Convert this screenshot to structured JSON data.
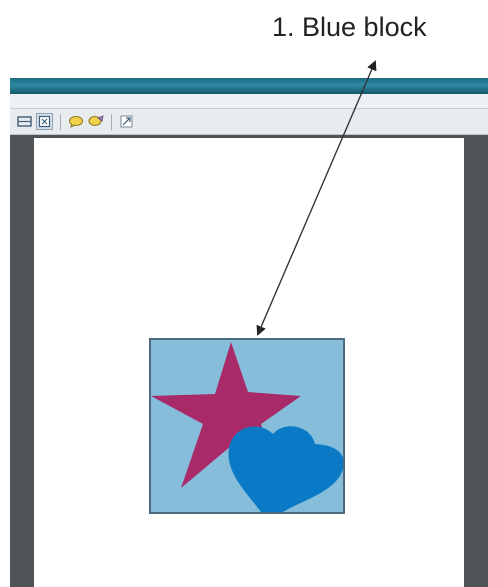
{
  "callout": {
    "label": "1. Blue block"
  },
  "colors": {
    "title_bar": "#2f8aa3",
    "workspace": "#4f5459",
    "page": "#ffffff",
    "blue_block": "#86bddb",
    "blue_block_border": "#4d6b7c",
    "star": "#a82a69",
    "heart": "#0b7ac6"
  },
  "toolbar": {
    "icons": [
      "fit-page-icon",
      "fit-width-icon",
      "comment-icon",
      "highlight-icon",
      "expand-icon"
    ]
  },
  "canvas": {
    "shapes": [
      "star",
      "heart"
    ]
  }
}
